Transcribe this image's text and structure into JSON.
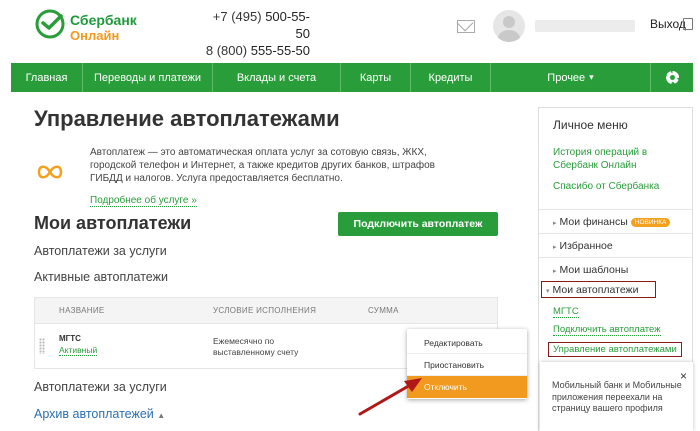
{
  "header": {
    "logo_line1": "Сбербанк",
    "logo_line2": "Онлайн",
    "phone1_prefix": "+7 (495)",
    "phone1_number": "500-55-50",
    "phone2_prefix": "8 (800)",
    "phone2_number": "555-55-50",
    "logout_label": "Выход"
  },
  "nav": {
    "items": [
      "Главная",
      "Переводы и платежи",
      "Вклады и счета",
      "Карты",
      "Кредиты",
      "Прочее"
    ],
    "more_caret": "▾"
  },
  "main": {
    "title": "Управление автоплатежами",
    "info_text": "Автоплатеж — это автоматическая оплата услуг за сотовую связь, ЖКХ, городской телефон и Интернет, а также кредитов других банков, штрафов ГИБДД и налогов. Услуга предоставляется бесплатно.",
    "more_link": "Подробнее об услуге »",
    "section_title": "Мои автоплатежи",
    "connect_button": "Подключить автоплатеж",
    "services_title": "Автоплатежи за услуги",
    "active_title": "Активные автоплатежи",
    "table": {
      "headers": [
        "Название",
        "Условие исполнения",
        "Сумма"
      ],
      "row": {
        "name": "МГТС",
        "status": "Активный",
        "condition": "Ежемесячно по выставленному счету"
      }
    },
    "services_title_2": "Автоплатежи за услуги",
    "archive_label": "Архив автоплатежей",
    "archive_caret": "▲"
  },
  "dropdown": {
    "items": [
      "Редактировать",
      "Приостановить",
      "Отключить"
    ],
    "highlight_color": "#f29a1f"
  },
  "sidebar": {
    "title": "Личное меню",
    "link_history": "История операций в Сбербанк Онлайн",
    "link_thanks": "Спасибо от Сбербанка",
    "sections": [
      "Мои финансы",
      "Избранное",
      "Мои шаблоны",
      "Мои автоплатежи"
    ],
    "badge": "новинка",
    "sub_items": [
      "МГТС",
      "Подключить автоплатеж",
      "Управление автоплатежами"
    ]
  },
  "popup": {
    "text": "Мобильный банк и Мобильные приложения переехали на страницу вашего профиля",
    "close": "×"
  },
  "colors": {
    "brand_green": "#2a9d3b",
    "accent_orange": "#f29a1f",
    "highlight_border": "#8b1a1a"
  }
}
